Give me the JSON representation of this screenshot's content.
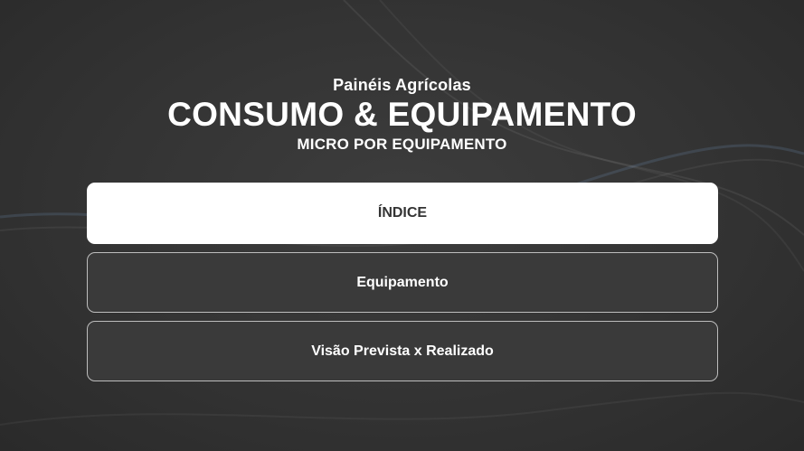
{
  "header": {
    "category": "Painéis Agrícolas",
    "title": "CONSUMO & EQUIPAMENTO",
    "subtitle": "MICRO POR EQUIPAMENTO"
  },
  "menu": {
    "items": [
      {
        "label": "ÍNDICE",
        "state": "active"
      },
      {
        "label": "Equipamento",
        "state": "default"
      },
      {
        "label": "Visão Prevista x Realizado",
        "state": "default"
      }
    ]
  },
  "colors": {
    "background": "#333333",
    "active_button_bg": "#ffffff",
    "active_button_text": "#333333",
    "button_border": "#bdbdbd",
    "wave_accent": "#6f8fb3"
  }
}
